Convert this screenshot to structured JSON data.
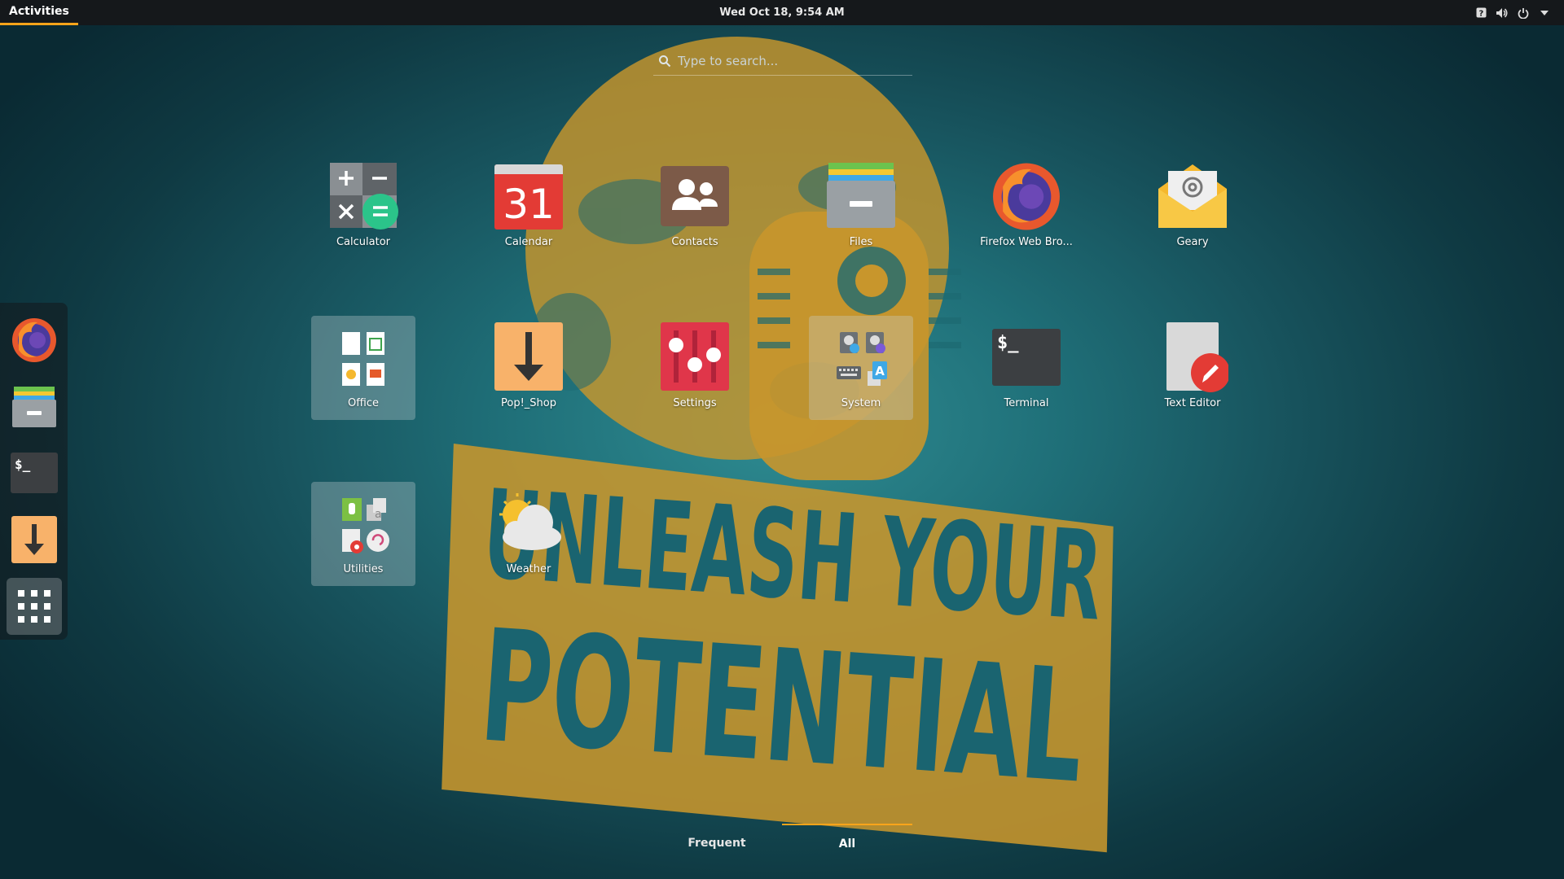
{
  "topbar": {
    "activities_label": "Activities",
    "clock": "Wed Oct 18,  9:54 AM",
    "tray_icons": [
      "help-icon",
      "volume-icon",
      "power-icon",
      "chevron-down-icon"
    ]
  },
  "search": {
    "placeholder": "Type to search..."
  },
  "dock": {
    "items": [
      {
        "icon": "firefox-icon"
      },
      {
        "icon": "files-icon"
      },
      {
        "icon": "terminal-icon"
      },
      {
        "icon": "pop-shop-icon"
      },
      {
        "icon": "show-apps-grid-icon",
        "active": true
      }
    ]
  },
  "apps": {
    "row1": [
      {
        "label": "Calculator"
      },
      {
        "label": "Calendar",
        "day": "31"
      },
      {
        "label": "Contacts"
      },
      {
        "label": "Files"
      },
      {
        "label": "Firefox Web Bro..."
      },
      {
        "label": "Geary"
      }
    ],
    "row2": [
      {
        "label": "Office",
        "folder": true
      },
      {
        "label": "Pop!_Shop"
      },
      {
        "label": "Settings"
      },
      {
        "label": "System",
        "folder": true
      },
      {
        "label": "Terminal",
        "prompt": "$_"
      },
      {
        "label": "Text Editor"
      }
    ],
    "row3": [
      {
        "label": "Utilities",
        "folder": true
      },
      {
        "label": "Weather"
      }
    ]
  },
  "wallpaper": {
    "line1": "UNLEASH YOUR",
    "line2": "POTENTIAL"
  },
  "tabs": [
    {
      "label": "Frequent",
      "selected": false
    },
    {
      "label": "All",
      "selected": true
    }
  ],
  "colors": {
    "accent": "#faa41a",
    "wallpaper_gold": "#c8962c",
    "topbar": "#15181b"
  }
}
